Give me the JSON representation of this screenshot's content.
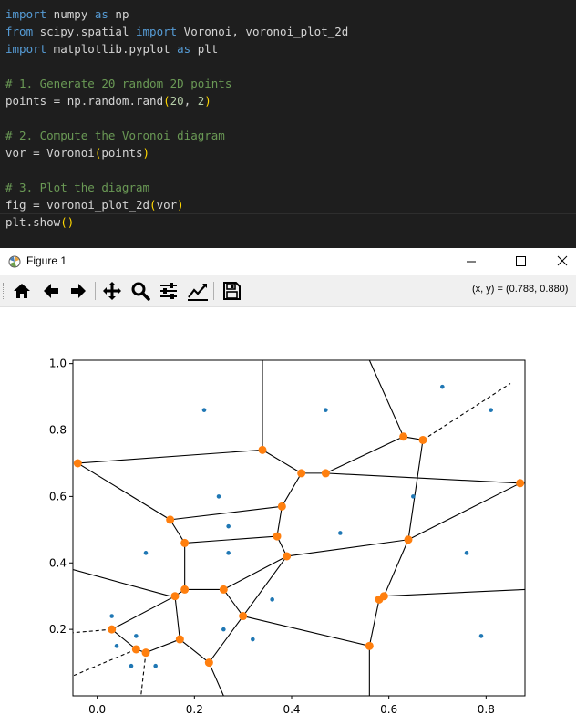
{
  "editor": {
    "line1": {
      "k1": "import",
      "t1": " numpy ",
      "k2": "as",
      "t2": " np"
    },
    "line2": {
      "k1": "from",
      "t1": " scipy.spatial ",
      "k2": "import",
      "t2": " Voronoi, voronoi_plot_2d"
    },
    "line3": {
      "k1": "import",
      "t1": " matplotlib.pyplot ",
      "k2": "as",
      "t2": " plt"
    },
    "line5": "# 1. Generate 20 random 2D points",
    "line6": {
      "a": "points = np.random.rand",
      "p1": "(",
      "n1": "20",
      "c": ", ",
      "n2": "2",
      "p2": ")"
    },
    "line8": "# 2. Compute the Voronoi diagram",
    "line9": {
      "a": "vor = Voronoi",
      "p1": "(",
      "b": "points",
      "p2": ")"
    },
    "line11": "# 3. Plot the diagram",
    "line12": {
      "a": "fig = voronoi_plot_2d",
      "p1": "(",
      "b": "vor",
      "p2": ")"
    },
    "line13": {
      "a": "plt.show",
      "p": "()"
    }
  },
  "window": {
    "title": "Figure 1",
    "coords": "(x, y) = (0.788, 0.880)"
  },
  "toolbar": {
    "icons": [
      "home-icon",
      "back-arrow-icon",
      "forward-arrow-icon",
      "pan-icon",
      "zoom-icon",
      "subplots-icon",
      "customize-icon",
      "save-icon"
    ]
  },
  "colors": {
    "points": "#1f77b4",
    "vertices": "#ff7f0e",
    "edges": "#000000"
  },
  "chart_data": {
    "type": "scatter",
    "title": "",
    "xlim": [
      -0.05,
      0.88
    ],
    "ylim": [
      0.0,
      1.01
    ],
    "xticks": [
      "0.0",
      "0.2",
      "0.4",
      "0.6",
      "0.8"
    ],
    "yticks": [
      "0.2",
      "0.4",
      "0.6",
      "0.8",
      "1.0"
    ],
    "input_points": [
      [
        0.22,
        0.86
      ],
      [
        0.47,
        0.86
      ],
      [
        0.71,
        0.93
      ],
      [
        0.81,
        0.86
      ],
      [
        0.25,
        0.6
      ],
      [
        0.65,
        0.6
      ],
      [
        0.27,
        0.51
      ],
      [
        0.5,
        0.49
      ],
      [
        0.1,
        0.43
      ],
      [
        0.27,
        0.43
      ],
      [
        0.76,
        0.43
      ],
      [
        0.36,
        0.29
      ],
      [
        0.03,
        0.24
      ],
      [
        0.26,
        0.2
      ],
      [
        0.08,
        0.18
      ],
      [
        0.04,
        0.15
      ],
      [
        0.32,
        0.17
      ],
      [
        0.79,
        0.18
      ],
      [
        0.07,
        0.09
      ],
      [
        0.12,
        0.09
      ]
    ],
    "vertices": [
      [
        -0.04,
        0.7
      ],
      [
        0.34,
        0.74
      ],
      [
        0.63,
        0.78
      ],
      [
        0.67,
        0.77
      ],
      [
        0.42,
        0.67
      ],
      [
        0.47,
        0.67
      ],
      [
        0.87,
        0.64
      ],
      [
        0.38,
        0.57
      ],
      [
        0.15,
        0.53
      ],
      [
        0.18,
        0.46
      ],
      [
        0.37,
        0.48
      ],
      [
        0.39,
        0.42
      ],
      [
        0.64,
        0.47
      ],
      [
        0.16,
        0.3
      ],
      [
        0.18,
        0.32
      ],
      [
        0.26,
        0.32
      ],
      [
        0.58,
        0.29
      ],
      [
        0.59,
        0.3
      ],
      [
        0.03,
        0.2
      ],
      [
        0.3,
        0.24
      ],
      [
        0.17,
        0.17
      ],
      [
        0.08,
        0.14
      ],
      [
        0.1,
        0.13
      ],
      [
        0.56,
        0.15
      ],
      [
        0.23,
        0.1
      ]
    ],
    "edges": [
      [
        0,
        1
      ],
      [
        1,
        4
      ],
      [
        4,
        5
      ],
      [
        5,
        2
      ],
      [
        2,
        3
      ],
      [
        5,
        6
      ],
      [
        6,
        12
      ],
      [
        12,
        3
      ],
      [
        4,
        7
      ],
      [
        7,
        8
      ],
      [
        8,
        0
      ],
      [
        8,
        9
      ],
      [
        9,
        10
      ],
      [
        10,
        7
      ],
      [
        10,
        11
      ],
      [
        11,
        12
      ],
      [
        12,
        17
      ],
      [
        16,
        23
      ],
      [
        23,
        19
      ],
      [
        19,
        11
      ],
      [
        9,
        14
      ],
      [
        14,
        15
      ],
      [
        15,
        11
      ],
      [
        14,
        13
      ],
      [
        13,
        18
      ],
      [
        18,
        21
      ],
      [
        21,
        22
      ],
      [
        22,
        20
      ],
      [
        20,
        13
      ],
      [
        20,
        24
      ],
      [
        24,
        19
      ],
      [
        15,
        19
      ],
      [
        17,
        16
      ]
    ],
    "open_edges": [
      [
        [
          0.34,
          0.74
        ],
        [
          0.34,
          1.01
        ]
      ],
      [
        [
          0.63,
          0.78
        ],
        [
          0.56,
          1.01
        ]
      ],
      [
        [
          0.87,
          0.64
        ],
        [
          0.88,
          0.64
        ]
      ],
      [
        [
          0.59,
          0.3
        ],
        [
          0.88,
          0.32
        ]
      ],
      [
        [
          -0.05,
          0.38
        ],
        [
          0.15,
          0.3
        ]
      ],
      [
        [
          0.56,
          0.15
        ],
        [
          0.56,
          0.0
        ]
      ],
      [
        [
          0.23,
          0.1
        ],
        [
          0.26,
          0.0
        ]
      ]
    ],
    "dashed_edges": [
      [
        [
          0.67,
          0.77
        ],
        [
          0.85,
          0.94
        ]
      ],
      [
        [
          0.03,
          0.2
        ],
        [
          -0.05,
          0.19
        ]
      ],
      [
        [
          0.08,
          0.14
        ],
        [
          -0.05,
          0.06
        ]
      ],
      [
        [
          0.1,
          0.13
        ],
        [
          0.09,
          0.0
        ]
      ]
    ]
  }
}
